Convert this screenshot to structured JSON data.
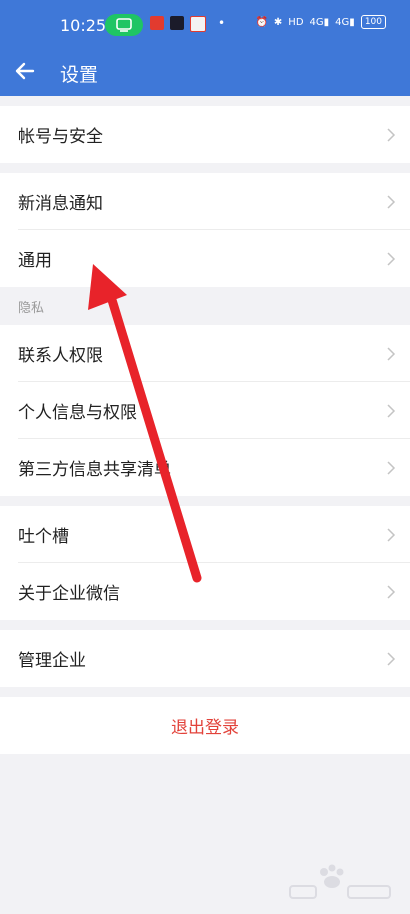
{
  "status_bar": {
    "time": "10:25",
    "icons": [
      "cast-icon",
      "app-icon",
      "app-icon",
      "app-icon",
      "alarm-icon",
      "bluetooth-icon",
      "hd-icon",
      "signal-icon",
      "signal-icon"
    ],
    "battery": "100",
    "hd_label": "HD",
    "signal_labels": [
      "4G",
      "4G"
    ]
  },
  "header": {
    "title": "设置",
    "bg_color": "#3f78d8"
  },
  "groups": [
    {
      "items": [
        {
          "label": "帐号与安全"
        }
      ]
    },
    {
      "items": [
        {
          "label": "新消息通知"
        },
        {
          "label": "通用"
        }
      ]
    },
    {
      "section_label": "隐私",
      "items": [
        {
          "label": "联系人权限"
        },
        {
          "label": "个人信息与权限"
        },
        {
          "label": "第三方信息共享清单"
        }
      ]
    },
    {
      "items": [
        {
          "label": "吐个槽"
        },
        {
          "label": "关于企业微信"
        }
      ]
    },
    {
      "items": [
        {
          "label": "管理企业"
        }
      ]
    }
  ],
  "logout": {
    "label": "退出登录",
    "color": "#e2423a"
  },
  "annotation": {
    "color": "#e8232a"
  }
}
